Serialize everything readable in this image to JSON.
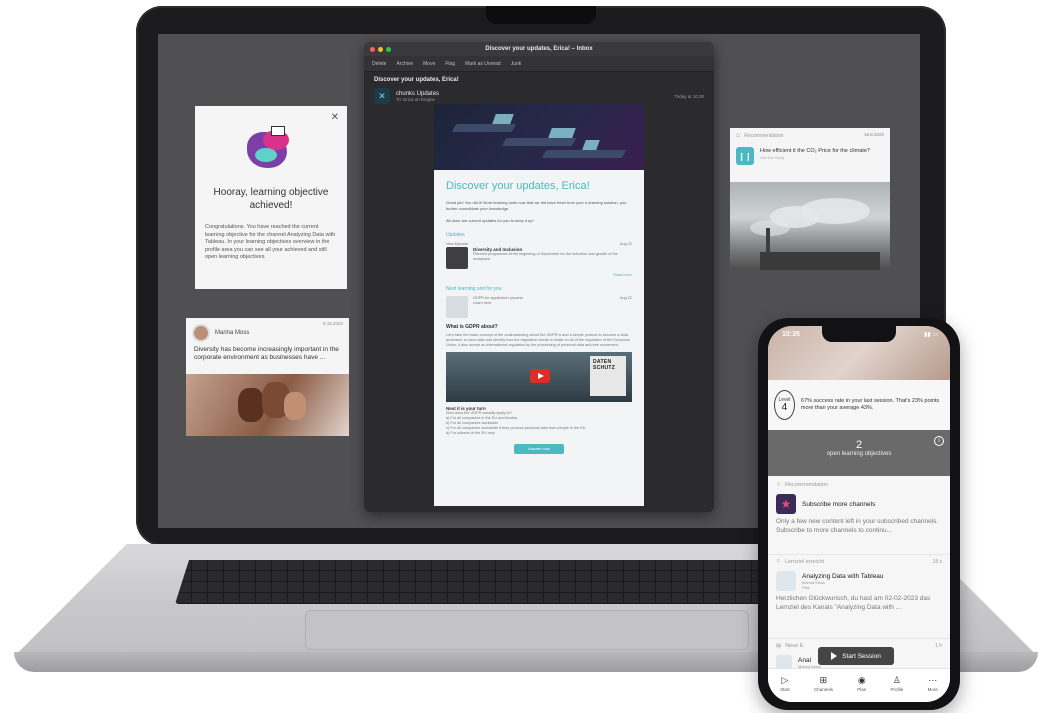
{
  "mail": {
    "window_title": "Discover your updates, Erica! – Inbox",
    "toolbar": [
      "Delete",
      "Archive",
      "Move",
      "Flag",
      "Mark as Unread",
      "Junk"
    ],
    "subject": "Discover your updates, Erica!",
    "sender_name": "chunks Updates",
    "to_label": "To:",
    "to_value": "Erica an Engine",
    "date": "Today at 10:30",
    "email": {
      "headline": "Discover your updates, Erica!",
      "intro": "Great job! You did it! More learning units now that we did have fresh from your e-learning solution, you further consolidate your knowledge.",
      "intro2": "All done are current updates for you to keep it up!",
      "sec_updates": "Updates",
      "new_episode": "New Episode",
      "new_episode_date": "Aug 22",
      "item1_title": "Diversity and Inclusion",
      "item1_text": "Planned programme at the beginning of September for the induction and growth of the workplace.",
      "item1_link": "Read more",
      "sec_next": "Next learning unit for you",
      "item2_title": "GDPR for application process",
      "item2_sub": "Learn here",
      "item2_date": "Aug 22",
      "question": "What is GDPR about?",
      "q_text": "Let's take the basic concept of the understanding about the GDPR is and a simple product to become a data, processor to have data and identify how the regulation needs to relate on all of the regulation of the European Union, it also accept an international regulation by the processing of personal data and free movement.",
      "video_sign": "DATEN SCHUTZ",
      "next_label": "Next it is your turn",
      "next_q": "Who does the GDPR actually apply to?",
      "opt_a": "a) For all companies in the EU and Austria",
      "opt_b": "b) For all companies worldwide",
      "opt_c": "c) For all companies worldwide if they process personal data from people in the EU",
      "opt_d": "d) For citizens of the EU only",
      "cta": "Answer now"
    }
  },
  "achievement": {
    "title": "Hooray, learning objective achieved!",
    "text": "Congratulations. You have reached the current learning objective for the channel Analyzing Data with Tableau. In your learning objectives overview in the profile area you can see all your achieved and still open learning objectives."
  },
  "marina": {
    "name": "Marina Moss",
    "date": "8.10.2022",
    "text": "Diversity has become increasingly important in the corporate environment as businesses have ..."
  },
  "recommendation": {
    "label": "Recommendation",
    "date": "18.8.2022",
    "question": "How efficient it the CO₂ Price for the climate?",
    "sub": "See the Story"
  },
  "phone": {
    "time": "10:35",
    "battery": "●",
    "level_label": "Level",
    "level_number": "4",
    "stat_line": "67% success rate in your last session. That's 23% points more than your average 43%.",
    "open_count": "2",
    "open_label": "open learning objectives",
    "reco_label": "Recommendation",
    "reco_title": "Subscribe more channels",
    "reco_text": "Only a few new content left in your subscribed channels. Subscribe to more channels to continu...",
    "goal_label": "Lernziel erreicht",
    "goal_count": "18 s",
    "goal_title": "Analyzing Data with Tableau",
    "goal_author": "Marina Moss",
    "goal_kind": "Play",
    "goal_text": "Herzlichen Glückwunsch, du hast am 02-02-2023 das Lernziel des Kanals \"Analyzing Data with ...",
    "news_label": "Neue E",
    "news_count": "1 h",
    "news_title": "Anal",
    "news_author": "Marina Moss",
    "start_button": "Start Session",
    "nav": [
      {
        "label": "Start",
        "icon": "▷"
      },
      {
        "label": "Channels",
        "icon": "⊞"
      },
      {
        "label": "Plan",
        "icon": "◉"
      },
      {
        "label": "Profile",
        "icon": "♙"
      },
      {
        "label": "More",
        "icon": "⋯"
      }
    ]
  }
}
